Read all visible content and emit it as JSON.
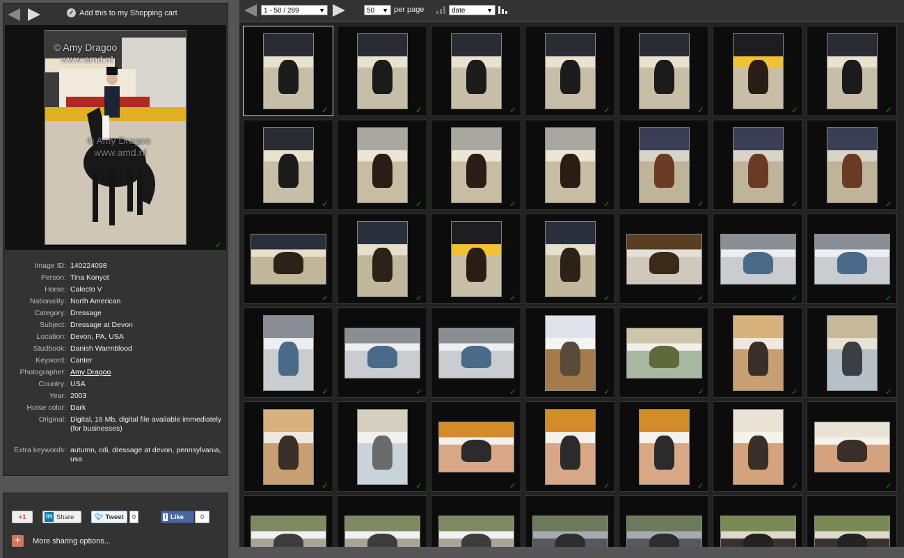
{
  "toolbar": {
    "add_to_cart_label": "Add this to my Shopping cart",
    "page_select_value": "1 - 50 / 289",
    "per_page_value": "50",
    "per_page_label": "per page",
    "sort_value": "date"
  },
  "preview": {
    "watermark_line1": "© Amy Dragoo",
    "watermark_line2": "www.amd.nl"
  },
  "details": [
    {
      "label": "Image ID:",
      "value": "140224098"
    },
    {
      "label": "Person:",
      "value": "Tina Konyot"
    },
    {
      "label": "Horse:",
      "value": "Calecto V"
    },
    {
      "label": "Nationality:",
      "value": "North American"
    },
    {
      "label": "Category:",
      "value": "Dressage"
    },
    {
      "label": "Subject:",
      "value": "Dressage at Devon"
    },
    {
      "label": "Location:",
      "value": "Devon, PA, USA"
    },
    {
      "label": "Studbook:",
      "value": "Danish Warmblood"
    },
    {
      "label": "Keyword:",
      "value": "Canter"
    },
    {
      "label": "Photographer:",
      "value": "Amy Dragoo"
    },
    {
      "label": "Country:",
      "value": "USA"
    },
    {
      "label": "Year:",
      "value": "2003"
    },
    {
      "label": "Horse color:",
      "value": "Dark"
    },
    {
      "label": "Original:",
      "value": "Digital, 16 Mb, digital file available immediately (for businesses)"
    },
    {
      "label": "Extra keywords:",
      "value": "autumn, cdi, dressage at devon, pennsylvania, usa"
    }
  ],
  "share": {
    "gplus_label": "+1",
    "linkedin_label": "Share",
    "linkedin_logo": "in",
    "tweet_label": "Tweet",
    "tweet_count": "0",
    "fb_logo": "f",
    "fb_like_label": "Like",
    "like_count": "0",
    "more_label": "More sharing options..."
  },
  "thumbnails": [
    {
      "orient": "portrait",
      "palette": "dressage-night"
    },
    {
      "orient": "portrait",
      "palette": "dressage-night"
    },
    {
      "orient": "portrait",
      "palette": "dressage-night"
    },
    {
      "orient": "portrait",
      "palette": "dressage-night"
    },
    {
      "orient": "portrait",
      "palette": "dressage-night"
    },
    {
      "orient": "portrait",
      "palette": "dressage-sign"
    },
    {
      "orient": "portrait",
      "palette": "dressage-night"
    },
    {
      "orient": "portrait",
      "palette": "dressage-night"
    },
    {
      "orient": "portrait",
      "palette": "dressage-day"
    },
    {
      "orient": "portrait",
      "palette": "dressage-day"
    },
    {
      "orient": "portrait",
      "palette": "dressage-day"
    },
    {
      "orient": "portrait",
      "palette": "paint-horse"
    },
    {
      "orient": "portrait",
      "palette": "paint-horse"
    },
    {
      "orient": "portrait",
      "palette": "paint-horse"
    },
    {
      "orient": "landscape",
      "palette": "arena-fall"
    },
    {
      "orient": "portrait",
      "palette": "arena-fall"
    },
    {
      "orient": "portrait",
      "palette": "dressage-sign"
    },
    {
      "orient": "portrait",
      "palette": "arena-fall"
    },
    {
      "orient": "landscape",
      "palette": "box-brown"
    },
    {
      "orient": "landscape",
      "palette": "box-white"
    },
    {
      "orient": "landscape",
      "palette": "box-white"
    },
    {
      "orient": "portrait",
      "palette": "box-white"
    },
    {
      "orient": "landscape",
      "palette": "box-white"
    },
    {
      "orient": "landscape",
      "palette": "box-white"
    },
    {
      "orient": "portrait",
      "palette": "box-wood"
    },
    {
      "orient": "landscape",
      "palette": "lab-tray"
    },
    {
      "orient": "portrait",
      "palette": "lab-hand"
    },
    {
      "orient": "portrait",
      "palette": "lab-tubes"
    },
    {
      "orient": "portrait",
      "palette": "lab-hand"
    },
    {
      "orient": "portrait",
      "palette": "lab-white"
    },
    {
      "orient": "landscape",
      "palette": "vet-orange"
    },
    {
      "orient": "portrait",
      "palette": "vet-orange"
    },
    {
      "orient": "portrait",
      "palette": "vet-orange"
    },
    {
      "orient": "portrait",
      "palette": "vet-wall"
    },
    {
      "orient": "landscape",
      "palette": "vet-wall"
    },
    {
      "orient": "landscape",
      "palette": "man-outdoor"
    },
    {
      "orient": "landscape",
      "palette": "man-outdoor"
    },
    {
      "orient": "landscape",
      "palette": "man-outdoor"
    },
    {
      "orient": "landscape",
      "palette": "horse-grey"
    },
    {
      "orient": "landscape",
      "palette": "horse-grey"
    },
    {
      "orient": "landscape",
      "palette": "horse-field"
    },
    {
      "orient": "landscape",
      "palette": "horse-field"
    }
  ]
}
